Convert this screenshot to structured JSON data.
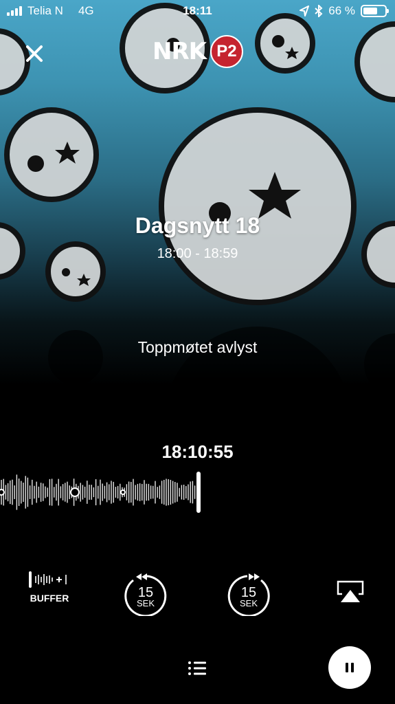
{
  "status_bar": {
    "carrier": "Telia N",
    "network": "4G",
    "time": "18:11",
    "battery": "66 %",
    "battery_level": 0.66
  },
  "header": {
    "logo_text": "NRK",
    "channel_badge": "P2"
  },
  "program": {
    "title": "Dagsnytt 18",
    "time_range": "18:00 - 18:59",
    "segment_title": "Toppmøtet avlyst"
  },
  "playback": {
    "current_time": "18:10:55"
  },
  "controls": {
    "buffer_label": "BUFFER",
    "skip_back": {
      "amount": "15",
      "unit": "SEK"
    },
    "skip_forward": {
      "amount": "15",
      "unit": "SEK"
    }
  },
  "colors": {
    "accent_red": "#c5242f",
    "bg_top": "#4aa6c8",
    "bg_bottom": "#000000"
  }
}
